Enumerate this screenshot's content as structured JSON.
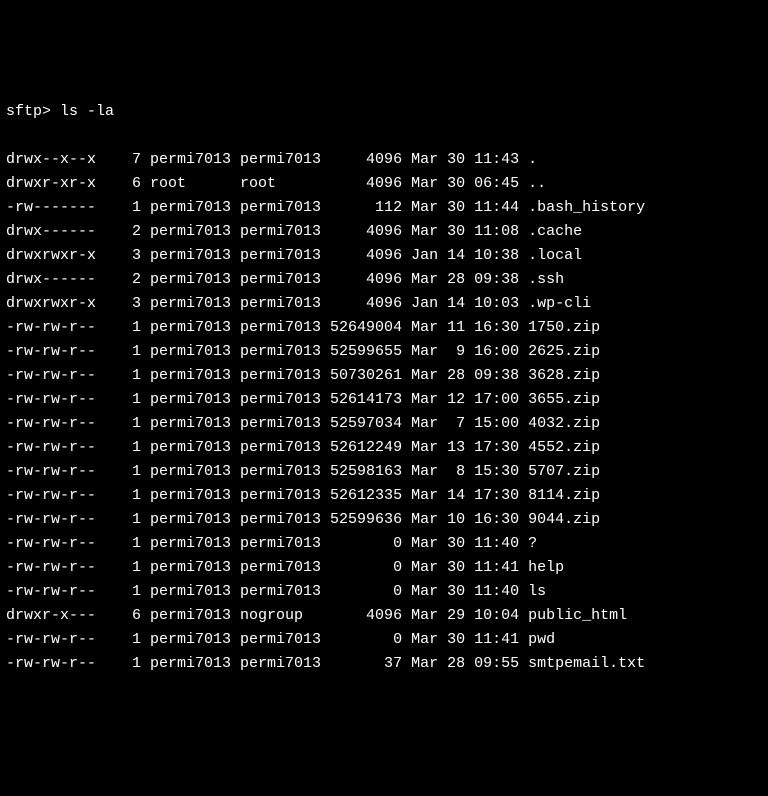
{
  "prompt": "sftp>",
  "command": "ls -la",
  "entries": [
    {
      "perms": "drwx--x--x",
      "links": "7",
      "owner": "permi7013",
      "group": "permi7013",
      "size": "4096",
      "month": "Mar",
      "day": "30",
      "time": "11:43",
      "name": "."
    },
    {
      "perms": "drwxr-xr-x",
      "links": "6",
      "owner": "root",
      "group": "root",
      "size": "4096",
      "month": "Mar",
      "day": "30",
      "time": "06:45",
      "name": ".."
    },
    {
      "perms": "-rw-------",
      "links": "1",
      "owner": "permi7013",
      "group": "permi7013",
      "size": "112",
      "month": "Mar",
      "day": "30",
      "time": "11:44",
      "name": ".bash_history"
    },
    {
      "perms": "drwx------",
      "links": "2",
      "owner": "permi7013",
      "group": "permi7013",
      "size": "4096",
      "month": "Mar",
      "day": "30",
      "time": "11:08",
      "name": ".cache"
    },
    {
      "perms": "drwxrwxr-x",
      "links": "3",
      "owner": "permi7013",
      "group": "permi7013",
      "size": "4096",
      "month": "Jan",
      "day": "14",
      "time": "10:38",
      "name": ".local"
    },
    {
      "perms": "drwx------",
      "links": "2",
      "owner": "permi7013",
      "group": "permi7013",
      "size": "4096",
      "month": "Mar",
      "day": "28",
      "time": "09:38",
      "name": ".ssh"
    },
    {
      "perms": "drwxrwxr-x",
      "links": "3",
      "owner": "permi7013",
      "group": "permi7013",
      "size": "4096",
      "month": "Jan",
      "day": "14",
      "time": "10:03",
      "name": ".wp-cli"
    },
    {
      "perms": "-rw-rw-r--",
      "links": "1",
      "owner": "permi7013",
      "group": "permi7013",
      "size": "52649004",
      "month": "Mar",
      "day": "11",
      "time": "16:30",
      "name": "1750.zip"
    },
    {
      "perms": "-rw-rw-r--",
      "links": "1",
      "owner": "permi7013",
      "group": "permi7013",
      "size": "52599655",
      "month": "Mar",
      "day": "9",
      "time": "16:00",
      "name": "2625.zip"
    },
    {
      "perms": "-rw-rw-r--",
      "links": "1",
      "owner": "permi7013",
      "group": "permi7013",
      "size": "50730261",
      "month": "Mar",
      "day": "28",
      "time": "09:38",
      "name": "3628.zip"
    },
    {
      "perms": "-rw-rw-r--",
      "links": "1",
      "owner": "permi7013",
      "group": "permi7013",
      "size": "52614173",
      "month": "Mar",
      "day": "12",
      "time": "17:00",
      "name": "3655.zip"
    },
    {
      "perms": "-rw-rw-r--",
      "links": "1",
      "owner": "permi7013",
      "group": "permi7013",
      "size": "52597034",
      "month": "Mar",
      "day": "7",
      "time": "15:00",
      "name": "4032.zip"
    },
    {
      "perms": "-rw-rw-r--",
      "links": "1",
      "owner": "permi7013",
      "group": "permi7013",
      "size": "52612249",
      "month": "Mar",
      "day": "13",
      "time": "17:30",
      "name": "4552.zip"
    },
    {
      "perms": "-rw-rw-r--",
      "links": "1",
      "owner": "permi7013",
      "group": "permi7013",
      "size": "52598163",
      "month": "Mar",
      "day": "8",
      "time": "15:30",
      "name": "5707.zip"
    },
    {
      "perms": "-rw-rw-r--",
      "links": "1",
      "owner": "permi7013",
      "group": "permi7013",
      "size": "52612335",
      "month": "Mar",
      "day": "14",
      "time": "17:30",
      "name": "8114.zip"
    },
    {
      "perms": "-rw-rw-r--",
      "links": "1",
      "owner": "permi7013",
      "group": "permi7013",
      "size": "52599636",
      "month": "Mar",
      "day": "10",
      "time": "16:30",
      "name": "9044.zip"
    },
    {
      "perms": "-rw-rw-r--",
      "links": "1",
      "owner": "permi7013",
      "group": "permi7013",
      "size": "0",
      "month": "Mar",
      "day": "30",
      "time": "11:40",
      "name": "?"
    },
    {
      "perms": "-rw-rw-r--",
      "links": "1",
      "owner": "permi7013",
      "group": "permi7013",
      "size": "0",
      "month": "Mar",
      "day": "30",
      "time": "11:41",
      "name": "help"
    },
    {
      "perms": "-rw-rw-r--",
      "links": "1",
      "owner": "permi7013",
      "group": "permi7013",
      "size": "0",
      "month": "Mar",
      "day": "30",
      "time": "11:40",
      "name": "ls"
    },
    {
      "perms": "drwxr-x---",
      "links": "6",
      "owner": "permi7013",
      "group": "nogroup",
      "size": "4096",
      "month": "Mar",
      "day": "29",
      "time": "10:04",
      "name": "public_html"
    },
    {
      "perms": "-rw-rw-r--",
      "links": "1",
      "owner": "permi7013",
      "group": "permi7013",
      "size": "0",
      "month": "Mar",
      "day": "30",
      "time": "11:41",
      "name": "pwd"
    },
    {
      "perms": "-rw-rw-r--",
      "links": "1",
      "owner": "permi7013",
      "group": "permi7013",
      "size": "37",
      "month": "Mar",
      "day": "28",
      "time": "09:55",
      "name": "smtpemail.txt"
    }
  ]
}
